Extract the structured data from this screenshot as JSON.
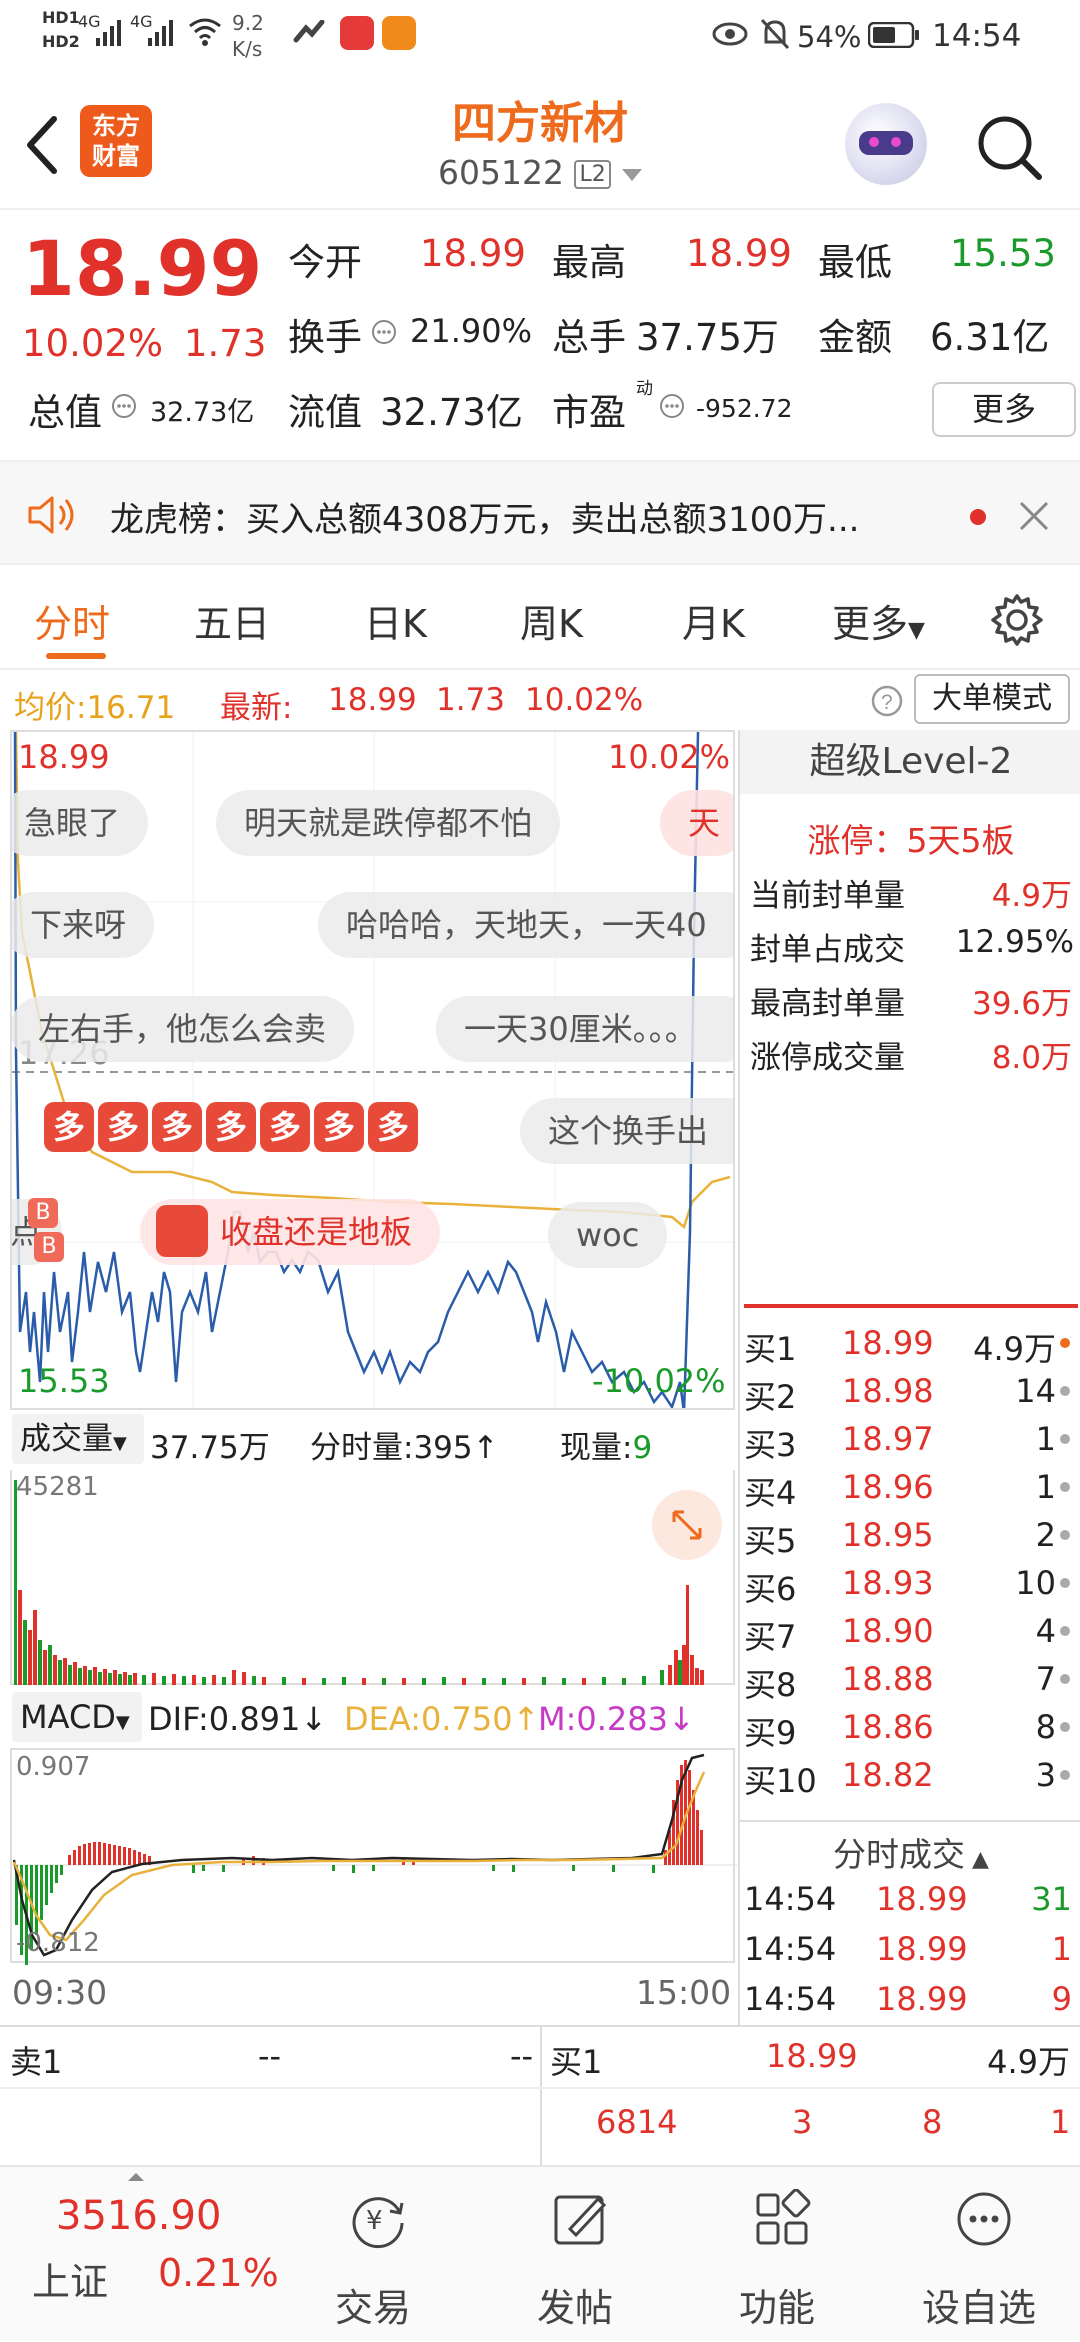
{
  "statusbar": {
    "net_speed": "9.2",
    "net_unit": "K/s",
    "battery": "54%",
    "time": "14:54",
    "hd1": "HD1",
    "hd2": "HD2",
    "sig1": "4G",
    "sig2": "4G"
  },
  "header": {
    "logo_line1": "东方",
    "logo_line2": "财富",
    "stock_name": "四方新材",
    "stock_code": "605122",
    "level": "L2"
  },
  "quote": {
    "price": "18.99",
    "change_pct": "10.02%",
    "change": "1.73",
    "open_label": "今开",
    "open": "18.99",
    "high_label": "最高",
    "high": "18.99",
    "low_label": "最低",
    "low": "15.53",
    "turnover_label": "换手",
    "turnover": "21.90%",
    "volume_label": "总手",
    "volume": "37.75万",
    "amount_label": "金额",
    "amount": "6.31亿",
    "mktcap_label": "总值",
    "mktcap": "32.73亿",
    "float_label": "流值",
    "float": "32.73亿",
    "pe_label": "市盈",
    "pe_sup": "动",
    "pe": "-952.72",
    "more": "更多"
  },
  "notice": {
    "text": "龙虎榜：买入总额4308万元，卖出总额3100万..."
  },
  "tabs": [
    {
      "label": "分时",
      "active": true
    },
    {
      "label": "五日"
    },
    {
      "label": "日K"
    },
    {
      "label": "周K"
    },
    {
      "label": "月K"
    },
    {
      "label": "更多"
    }
  ],
  "infobar": {
    "avg_label": "均价:",
    "avg": "16.71",
    "latest_label": "最新:",
    "latest": "18.99",
    "chg": "1.73",
    "pct": "10.02%",
    "bigorder": "大单模式"
  },
  "chart": {
    "top_price": "18.99",
    "top_pct": "10.02%",
    "mid_price": "17.26",
    "low_price": "15.53",
    "low_pct": "-10.02%",
    "b1": "B",
    "b2": "B",
    "danmu": [
      "急眼了",
      "明天就是跌停都不怕",
      "天",
      "下来呀",
      "哈哈哈，天地天，一天40",
      "左右手，他怎么会卖",
      "一天30厘米。。。",
      "这个换手出",
      "收盘还是地板",
      "woc",
      "点"
    ],
    "duo": [
      "多",
      "多",
      "多",
      "多",
      "多",
      "多",
      "多"
    ]
  },
  "volume": {
    "label": "成交量",
    "total": "37.75万",
    "minute_label": "分时量:",
    "minute": "395",
    "now_label": "现量:",
    "now": "9",
    "max": "45281"
  },
  "macd": {
    "label": "MACD",
    "dif": "DIF:0.891",
    "dea": "DEA:0.750",
    "m": "M:0.283",
    "top": "0.907",
    "bottom": "-0.812"
  },
  "time_axis": {
    "start": "09:30",
    "end": "15:00"
  },
  "level2": {
    "title": "超级Level-2",
    "limit": "涨停：5天5板",
    "stats": [
      {
        "label": "当前封单量",
        "value": "4.9万"
      },
      {
        "label": "封单占成交",
        "value": "12.95%"
      },
      {
        "label": "最高封单量",
        "value": "39.6万"
      },
      {
        "label": "涨停成交量",
        "value": "8.0万"
      }
    ],
    "bids": [
      {
        "label": "买1",
        "price": "18.99",
        "vol": "4.9万"
      },
      {
        "label": "买2",
        "price": "18.98",
        "vol": "14"
      },
      {
        "label": "买3",
        "price": "18.97",
        "vol": "1"
      },
      {
        "label": "买4",
        "price": "18.96",
        "vol": "1"
      },
      {
        "label": "买5",
        "price": "18.95",
        "vol": "2"
      },
      {
        "label": "买6",
        "price": "18.93",
        "vol": "10"
      },
      {
        "label": "买7",
        "price": "18.90",
        "vol": "4"
      },
      {
        "label": "买8",
        "price": "18.88",
        "vol": "7"
      },
      {
        "label": "买9",
        "price": "18.86",
        "vol": "8"
      },
      {
        "label": "买10",
        "price": "18.82",
        "vol": "3"
      }
    ],
    "trades_title": "分时成交",
    "trades": [
      {
        "time": "14:54",
        "price": "18.99",
        "vol": "31"
      },
      {
        "time": "14:54",
        "price": "18.99",
        "vol": "1"
      },
      {
        "time": "14:54",
        "price": "18.99",
        "vol": "9"
      }
    ]
  },
  "bottom_quote": {
    "sell_label": "卖1",
    "sell_price": "--",
    "sell_vol": "--",
    "buy_label": "买1",
    "buy_price": "18.99",
    "buy_vol": "4.9万",
    "q1": "6814",
    "q2": "3",
    "q3": "8",
    "q4": "1"
  },
  "index": {
    "value": "3516.90",
    "name": "上证",
    "pct": "0.21%"
  },
  "nav": [
    {
      "label": "交易"
    },
    {
      "label": "发帖"
    },
    {
      "label": "功能"
    },
    {
      "label": "设自选"
    }
  ],
  "colors": {
    "red": "#e0312a",
    "green": "#1a9a2a",
    "blue": "#2a5caa",
    "orange": "#ee6a1c",
    "avg_line": "#e8b13a"
  }
}
